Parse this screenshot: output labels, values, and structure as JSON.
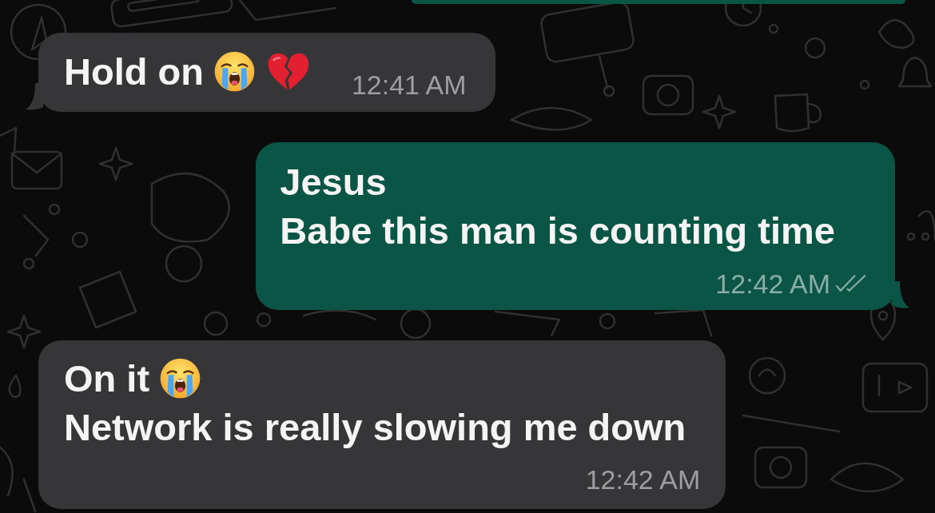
{
  "messages": [
    {
      "kind": "incoming",
      "tail": true,
      "lines": [
        {
          "text": "Hold on",
          "emoji": [
            {
              "kind": "crying"
            },
            {
              "kind": "heartbreak"
            }
          ]
        }
      ],
      "time": "12:41 AM"
    },
    {
      "kind": "outgoing",
      "tail": true,
      "lines": [
        {
          "text": "Jesus"
        },
        {
          "text": "Babe this man is counting time"
        }
      ],
      "time": "12:42 AM",
      "read": false
    },
    {
      "kind": "incoming",
      "tail": false,
      "lines": [
        {
          "text": "On it",
          "emoji": [
            {
              "kind": "crying"
            }
          ]
        },
        {
          "text": "Network is really slowing me down"
        }
      ],
      "time": "12:42 AM"
    }
  ]
}
